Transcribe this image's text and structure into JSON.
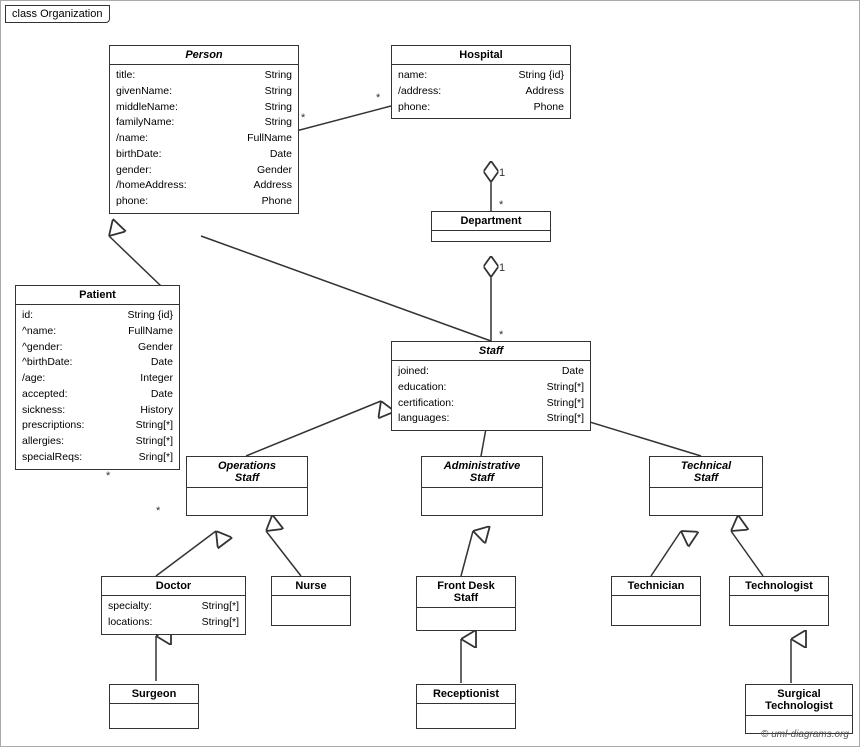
{
  "diagram": {
    "title": "class Organization",
    "copyright": "© uml-diagrams.org",
    "classes": {
      "person": {
        "name": "Person",
        "italic": true,
        "attrs": [
          [
            "title:",
            "String"
          ],
          [
            "givenName:",
            "String"
          ],
          [
            "middleName:",
            "String"
          ],
          [
            "familyName:",
            "String"
          ],
          [
            "/name:",
            "FullName"
          ],
          [
            "birthDate:",
            "Date"
          ],
          [
            "gender:",
            "Gender"
          ],
          [
            "/homeAddress:",
            "Address"
          ],
          [
            "phone:",
            "Phone"
          ]
        ]
      },
      "hospital": {
        "name": "Hospital",
        "italic": false,
        "attrs": [
          [
            "name:",
            "String {id}"
          ],
          [
            "/address:",
            "Address"
          ],
          [
            "phone:",
            "Phone"
          ]
        ]
      },
      "department": {
        "name": "Department",
        "italic": false,
        "attrs": []
      },
      "staff": {
        "name": "Staff",
        "italic": true,
        "attrs": [
          [
            "joined:",
            "Date"
          ],
          [
            "education:",
            "String[*]"
          ],
          [
            "certification:",
            "String[*]"
          ],
          [
            "languages:",
            "String[*]"
          ]
        ]
      },
      "patient": {
        "name": "Patient",
        "italic": false,
        "attrs": [
          [
            "id:",
            "String {id}"
          ],
          [
            "^name:",
            "FullName"
          ],
          [
            "^gender:",
            "Gender"
          ],
          [
            "^birthDate:",
            "Date"
          ],
          [
            "/age:",
            "Integer"
          ],
          [
            "accepted:",
            "Date"
          ],
          [
            "sickness:",
            "History"
          ],
          [
            "prescriptions:",
            "String[*]"
          ],
          [
            "allergies:",
            "String[*]"
          ],
          [
            "specialReqs:",
            "Sring[*]"
          ]
        ]
      },
      "operations_staff": {
        "name": "Operations\nStaff",
        "italic": true,
        "attrs": []
      },
      "admin_staff": {
        "name": "Administrative\nStaff",
        "italic": true,
        "attrs": []
      },
      "technical_staff": {
        "name": "Technical\nStaff",
        "italic": true,
        "attrs": []
      },
      "doctor": {
        "name": "Doctor",
        "italic": false,
        "attrs": [
          [
            "specialty:",
            "String[*]"
          ],
          [
            "locations:",
            "String[*]"
          ]
        ]
      },
      "nurse": {
        "name": "Nurse",
        "italic": false,
        "attrs": []
      },
      "front_desk": {
        "name": "Front Desk\nStaff",
        "italic": false,
        "attrs": []
      },
      "technician": {
        "name": "Technician",
        "italic": false,
        "attrs": []
      },
      "technologist": {
        "name": "Technologist",
        "italic": false,
        "attrs": []
      },
      "surgeon": {
        "name": "Surgeon",
        "italic": false,
        "attrs": []
      },
      "receptionist": {
        "name": "Receptionist",
        "italic": false,
        "attrs": []
      },
      "surgical_technologist": {
        "name": "Surgical\nTechnologist",
        "italic": false,
        "attrs": []
      }
    }
  }
}
